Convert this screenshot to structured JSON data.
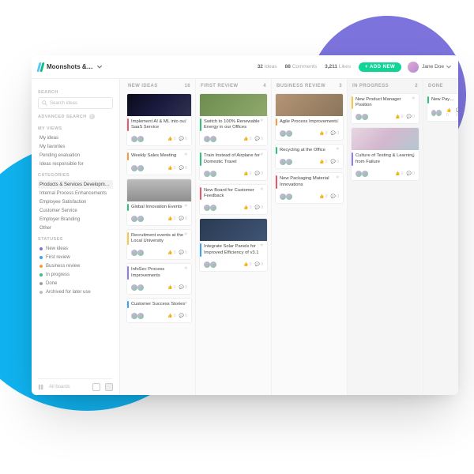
{
  "header": {
    "title": "Moonshots &…",
    "counts": {
      "ideas": "32",
      "ideas_label": "Ideas",
      "comments": "88",
      "comments_label": "Comments",
      "likes": "3,211",
      "likes_label": "Likes"
    },
    "add_label": "+ ADD NEW",
    "user_name": "Jane Doe"
  },
  "sidebar": {
    "search_label": "SEARCH",
    "search_placeholder": "Search ideas",
    "advanced": "ADVANCED SEARCH",
    "sections": {
      "myviews_label": "MY VIEWS",
      "myviews": [
        "My ideas",
        "My favorites",
        "Pending evaluation",
        "Ideas responsible for"
      ],
      "categories_label": "CATEGORIES",
      "categories": [
        "Products & Services Development",
        "Internal Process Enhancements",
        "Employee Satisfaction",
        "Customer Service",
        "Employer Branding",
        "Other"
      ],
      "statuses_label": "STATUSES",
      "statuses": [
        {
          "label": "New ideas",
          "color": "#7C73DC"
        },
        {
          "label": "First review",
          "color": "#3DA2F0"
        },
        {
          "label": "Business review",
          "color": "#F49C3E"
        },
        {
          "label": "In progress",
          "color": "#2EC27E"
        },
        {
          "label": "Done",
          "color": "#9E9E9E"
        },
        {
          "label": "Archived for later use",
          "color": "#BDBDBD"
        }
      ]
    },
    "footer": "All boards"
  },
  "columns": [
    {
      "title": "NEW IDEAS",
      "count": "16"
    },
    {
      "title": "FIRST REVIEW",
      "count": "4"
    },
    {
      "title": "BUSINESS REVIEW",
      "count": "3"
    },
    {
      "title": "IN PROGRESS",
      "count": "2"
    },
    {
      "title": "DONE",
      "count": ""
    }
  ],
  "cards": {
    "c0": [
      {
        "title": "Implement AI & ML into our SaaS Service",
        "img": "linear-gradient(135deg,#0a0a1a,#1a1a3f,#31314f)",
        "accent": "red"
      },
      {
        "title": "Weekly Sales Meeting",
        "img": "",
        "accent": "orange"
      },
      {
        "title": "Global Innovation Events",
        "img": "linear-gradient(180deg,#bcbcbc,#8e8e8e)",
        "accent": "green"
      },
      {
        "title": "Recruitment events at the Local University",
        "img": "",
        "accent": "yellow"
      },
      {
        "title": "InfoSec Process Improvements",
        "img": "",
        "accent": "purple"
      },
      {
        "title": "Customer Success Stories",
        "img": "",
        "accent": "blue"
      }
    ],
    "c1": [
      {
        "title": "Switch to 100% Renewable Energy in our Offices",
        "img": "linear-gradient(135deg,#6b8e4e,#91a86d)",
        "accent": "green"
      },
      {
        "title": "Train Instead of Airplane for Domestic Travel",
        "img": "",
        "accent": "green"
      },
      {
        "title": "New Board for Customer Feedback",
        "img": "",
        "accent": "red"
      },
      {
        "title": "Integrate Solar Panels for Improved Efficiency of v3.1",
        "img": "linear-gradient(135deg,#2a3a52,#3f5575)",
        "accent": "blue"
      }
    ],
    "c2": [
      {
        "title": "Agile Process Improvements",
        "img": "linear-gradient(135deg,#b59575,#8a755a)",
        "accent": "orange"
      },
      {
        "title": "Recycling at the Office",
        "img": "",
        "accent": "green"
      },
      {
        "title": "New Packaging Material Innovations",
        "img": "",
        "accent": "red"
      }
    ],
    "c3": [
      {
        "title": "New Product Manager Position",
        "img": "",
        "accent": "yellow"
      },
      {
        "title": "Culture of Testing & Learning from Failure",
        "img": "linear-gradient(135deg,#e7d6e2,#d3b8cf,#b4c7d0)",
        "accent": "purple"
      }
    ],
    "c4": [
      {
        "title": "New Pay…",
        "img": "",
        "accent": "green"
      }
    ]
  }
}
